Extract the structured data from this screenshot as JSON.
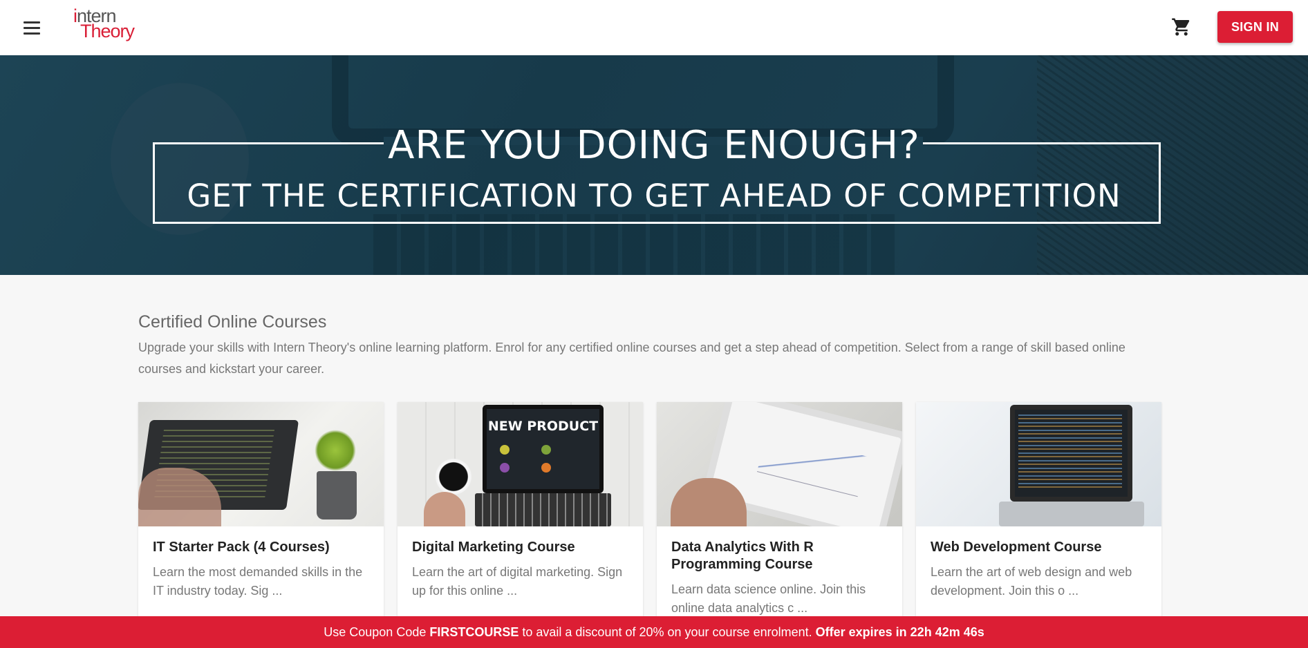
{
  "header": {
    "logo_line1_i": "i",
    "logo_line1_rest": "ntern",
    "logo_line2": "Theory",
    "signin_label": "SIGN IN"
  },
  "banner": {
    "headline": "ARE YOU DOING ENOUGH?",
    "subheadline": "GET THE CERTIFICATION TO GET AHEAD OF COMPETITION"
  },
  "section": {
    "title": "Certified Online Courses",
    "description": "Upgrade your skills with Intern Theory's online learning platform. Enrol for any certified online courses and get a step ahead of competition. Select from a range of skill based online courses and kickstart your career."
  },
  "courses": [
    {
      "title": "IT Starter Pack (4 Courses)",
      "description": "Learn the most demanded skills in the IT industry today. Sig ..."
    },
    {
      "title": "Digital Marketing Course",
      "description": "Learn the art of digital marketing. Sign up for this online ...",
      "image_text": "NEW PRODUCT"
    },
    {
      "title": "Data Analytics With R Programming Course",
      "description": "Learn data science online. Join this online data analytics c ..."
    },
    {
      "title": "Web Development Course",
      "description": "Learn the art of web design and web development. Join this o ..."
    }
  ],
  "promo": {
    "prefix": "Use Coupon Code ",
    "code": "FIRSTCOURSE",
    "middle": " to avail a discount of 20% on your course enrolment. ",
    "expiry": "Offer expires in 22h 42m 46s"
  },
  "icons": [
    "menu-icon",
    "cart-icon"
  ],
  "colors": {
    "brand_red": "#dc1e34",
    "banner_bg": "#1a3e4f"
  }
}
